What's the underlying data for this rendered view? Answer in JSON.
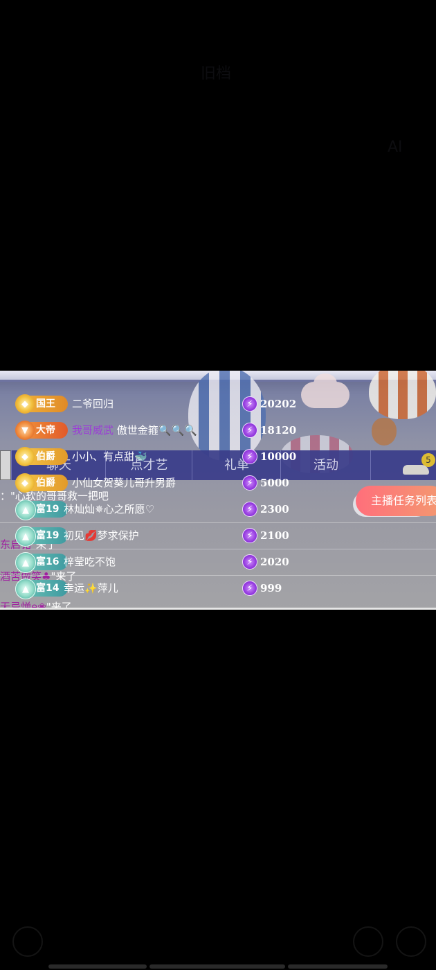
{
  "background_ghost": {
    "title": "旧档",
    "side": "AI"
  },
  "tabs": [
    {
      "label": "聊天",
      "badge": ""
    },
    {
      "label": "点才艺",
      "badge": ""
    },
    {
      "label": "礼单",
      "badge": ""
    },
    {
      "label": "活动",
      "badge": ""
    },
    {
      "label": "",
      "badge": "5"
    }
  ],
  "task_button": "主播任务列表",
  "chat_messages": [
    {
      "name": "",
      "text": "心软的哥哥救一把吧",
      "prefix": "：\""
    },
    {
      "name": "东启铭",
      "text": "\"来了"
    },
    {
      "name": "酒苦做笑♣",
      "text": "\"来了"
    },
    {
      "name": "无忌惮e❀",
      "text": "\"来了"
    }
  ],
  "ranking": [
    {
      "rank_label": "国王",
      "rank_type": "king",
      "name": "二爷回归",
      "name_extra": "",
      "score": "20202"
    },
    {
      "rank_label": "大帝",
      "rank_type": "emperor",
      "name": "我哥威武",
      "name_extra": "傲世金箍🔍🔍🔍",
      "score": "18120"
    },
    {
      "rank_label": "伯爵",
      "rank_type": "duke",
      "name": "小小、有点甜🐳",
      "name_extra": "",
      "score": "10000"
    },
    {
      "rank_label": "伯爵",
      "rank_type": "duke",
      "name": "小仙女贺葵儿哥升男爵",
      "name_extra": "",
      "score": "5000"
    },
    {
      "rank_label": "富19",
      "rank_type": "rich",
      "name": "林灿灿✵心之所愿♡",
      "name_extra": "",
      "score": "2300"
    },
    {
      "rank_label": "富19",
      "rank_type": "rich",
      "name": "初见💋梦求保护",
      "name_extra": "",
      "score": "2100"
    },
    {
      "rank_label": "富16",
      "rank_type": "rich",
      "name": "梓莹吃不饱",
      "name_extra": "",
      "score": "2020"
    },
    {
      "rank_label": "富14",
      "rank_type": "rich",
      "name": "幸运✨萍儿",
      "name_extra": "",
      "score": "999"
    }
  ],
  "colors": {
    "accent_purple": "#8a2fd8",
    "task_button": "#ff6f7b",
    "tab_bar": "#3a3d8a"
  }
}
